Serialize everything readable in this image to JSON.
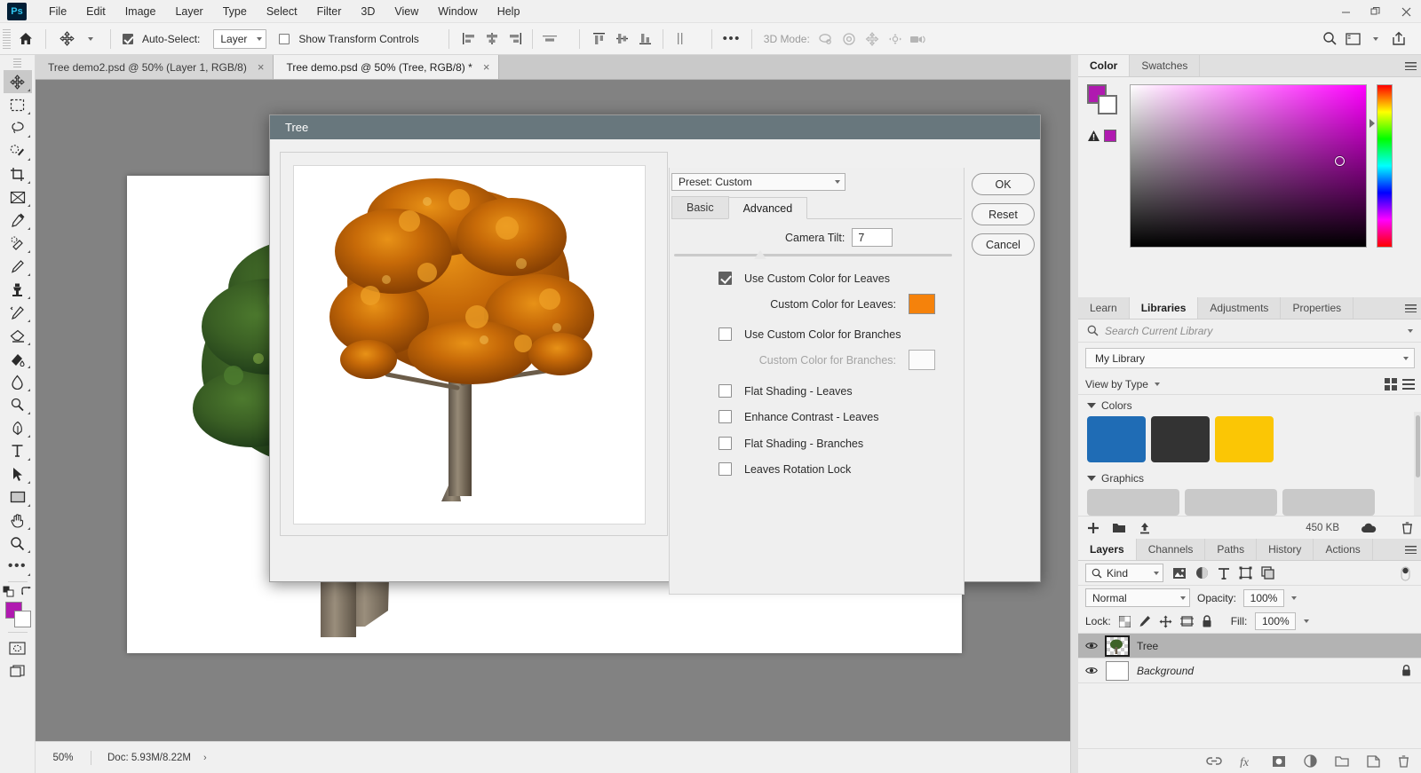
{
  "app": {
    "logo": "Ps",
    "menus": [
      "File",
      "Edit",
      "Image",
      "Layer",
      "Type",
      "Select",
      "Filter",
      "3D",
      "View",
      "Window",
      "Help"
    ],
    "window_controls": [
      "minimize",
      "restore",
      "close"
    ]
  },
  "options_bar": {
    "home_icon": "home-icon",
    "tool_icon": "move-tool-icon",
    "auto_select_label": "Auto-Select:",
    "auto_select_checked": true,
    "auto_select_target": "Layer",
    "show_transform_label": "Show Transform Controls",
    "show_transform_checked": false,
    "align_icons": [
      "align-left-edges",
      "align-horizontal-centers",
      "align-right-edges",
      "align-horizontal-distribute"
    ],
    "distribute_icons": [
      "align-top-edges",
      "align-vertical-centers",
      "align-bottom-edges",
      "distribute-vertical"
    ],
    "more_label": "•••",
    "three_d_mode_label": "3D Mode:",
    "three_d_icons": [
      "orbit-3d-icon",
      "roll-3d-icon",
      "pan-3d-icon",
      "slide-3d-icon",
      "camera-3d-icon"
    ],
    "right_icons": [
      "search-icon",
      "workspace-icon",
      "chevron-down-icon",
      "share-icon"
    ]
  },
  "tabs": [
    {
      "title": "Tree demo2.psd @ 50% (Layer 1, RGB/8)",
      "active": false,
      "close": "×"
    },
    {
      "title": "Tree demo.psd @ 50% (Tree, RGB/8) *",
      "active": true,
      "close": "×"
    }
  ],
  "toolbar": {
    "tools": [
      {
        "name": "move-tool",
        "active": true
      },
      {
        "name": "rectangular-marquee-tool",
        "active": false
      },
      {
        "name": "lasso-tool",
        "active": false
      },
      {
        "name": "quick-selection-tool",
        "active": false
      },
      {
        "name": "crop-tool",
        "active": false
      },
      {
        "name": "frame-tool",
        "active": false
      },
      {
        "name": "eyedropper-tool",
        "active": false
      },
      {
        "name": "spot-healing-brush-tool",
        "active": false
      },
      {
        "name": "brush-tool",
        "active": false
      },
      {
        "name": "clone-stamp-tool",
        "active": false
      },
      {
        "name": "history-brush-tool",
        "active": false
      },
      {
        "name": "eraser-tool",
        "active": false
      },
      {
        "name": "gradient-tool",
        "active": false
      },
      {
        "name": "blur-tool",
        "active": false
      },
      {
        "name": "dodge-tool",
        "active": false
      },
      {
        "name": "pen-tool",
        "active": false
      },
      {
        "name": "type-tool",
        "active": false
      },
      {
        "name": "path-selection-tool",
        "active": false
      },
      {
        "name": "rectangle-tool",
        "active": false
      },
      {
        "name": "hand-tool",
        "active": false
      },
      {
        "name": "zoom-tool",
        "active": false
      },
      {
        "name": "edit-toolbar-tool",
        "active": false
      }
    ],
    "foreground_color": "#b01ab0",
    "background_color": "#ffffff",
    "quick_mask_icon": "quick-mask-icon",
    "screen_mode_icon": "screen-mode-icon"
  },
  "status_bar": {
    "zoom": "50%",
    "doc_label": "Doc: 5.93M/8.22M",
    "arrow": "›"
  },
  "dialog": {
    "title": "Tree",
    "preset_label": "Preset: Custom",
    "tabs": [
      {
        "label": "Basic",
        "active": false
      },
      {
        "label": "Advanced",
        "active": true
      }
    ],
    "camera_tilt_label": "Camera Tilt:",
    "camera_tilt_value": "7",
    "options": [
      {
        "label": "Use Custom Color for Leaves",
        "checked": true,
        "disabled": false
      },
      {
        "label": "Use Custom Color for Branches",
        "checked": false,
        "disabled": false
      },
      {
        "label": "Flat Shading - Leaves",
        "checked": false,
        "disabled": false
      },
      {
        "label": "Enhance Contrast - Leaves",
        "checked": false,
        "disabled": false
      },
      {
        "label": "Flat Shading - Branches",
        "checked": false,
        "disabled": false
      },
      {
        "label": "Leaves Rotation Lock",
        "checked": false,
        "disabled": false
      }
    ],
    "custom_color_leaves_label": "Custom Color for Leaves:",
    "custom_color_leaves": "#f5820b",
    "custom_color_branches_label": "Custom Color for Branches:",
    "custom_color_branches": "#ffffff",
    "buttons": [
      {
        "label": "OK",
        "name": "ok-button"
      },
      {
        "label": "Reset",
        "name": "reset-button"
      },
      {
        "label": "Cancel",
        "name": "cancel-button"
      }
    ]
  },
  "color_panel": {
    "tabs": [
      {
        "label": "Color",
        "active": true
      },
      {
        "label": "Swatches",
        "active": false
      }
    ],
    "foreground_color": "#b01ab0",
    "background_color": "#ffffff",
    "out_of_gamut_icon": "gamut-warning-icon",
    "gamut_swatch": "#b01ab0"
  },
  "libraries_panel": {
    "tabs": [
      {
        "label": "Learn",
        "active": false
      },
      {
        "label": "Libraries",
        "active": true
      },
      {
        "label": "Adjustments",
        "active": false
      },
      {
        "label": "Properties",
        "active": false
      }
    ],
    "search_placeholder": "Search Current Library",
    "library_name": "My Library",
    "view_label": "View by Type",
    "sections": [
      {
        "label": "Colors",
        "swatches": [
          "#1f6cb5",
          "#333333",
          "#fbc605"
        ]
      },
      {
        "label": "Graphics",
        "items": 3
      }
    ],
    "footer_size": "450 KB",
    "footer_icons": [
      "add-icon",
      "folder-icon",
      "upload-icon",
      "cloud-icon",
      "trash-icon"
    ]
  },
  "layers_panel": {
    "tabs": [
      {
        "label": "Layers",
        "active": true
      },
      {
        "label": "Channels",
        "active": false
      },
      {
        "label": "Paths",
        "active": false
      },
      {
        "label": "History",
        "active": false
      },
      {
        "label": "Actions",
        "active": false
      }
    ],
    "filter_label": "Kind",
    "filter_icons": [
      "pixel-layers-icon",
      "adjustment-layers-icon",
      "type-layers-icon",
      "shape-layers-icon",
      "smart-object-icon",
      "filter-toggle-icon"
    ],
    "blend_mode": "Normal",
    "opacity_label": "Opacity:",
    "opacity_value": "100%",
    "lock_label": "Lock:",
    "lock_icons": [
      "lock-transparent-pixels-icon",
      "lock-image-pixels-icon",
      "lock-position-icon",
      "lock-artboard-icon",
      "lock-all-icon"
    ],
    "fill_label": "Fill:",
    "fill_value": "100%",
    "layers": [
      {
        "name": "Tree",
        "visible": true,
        "selected": true,
        "locked": false,
        "italic": false
      },
      {
        "name": "Background",
        "visible": true,
        "selected": false,
        "locked": true,
        "italic": true
      }
    ],
    "footer_icons": [
      "link-layers-icon",
      "layer-style-icon",
      "layer-mask-icon",
      "adjustment-layer-icon",
      "new-group-icon",
      "new-layer-icon",
      "delete-layer-icon"
    ]
  }
}
